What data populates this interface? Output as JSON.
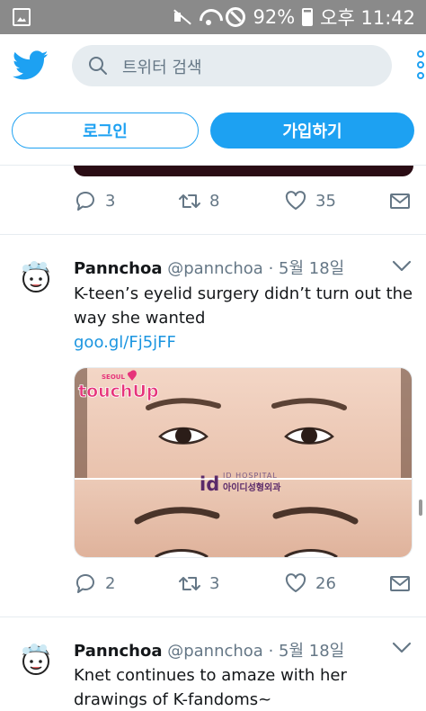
{
  "status_bar": {
    "battery": "92%",
    "time": "오후 11:42"
  },
  "header": {
    "search_placeholder": "트위터 검색"
  },
  "auth": {
    "login_label": "로그인",
    "signup_label": "가입하기"
  },
  "prev_tweet_actions": {
    "replies": "3",
    "retweets": "8",
    "likes": "35"
  },
  "tweets": [
    {
      "name": "Pannchoa",
      "handle": "@pannchoa",
      "dot": "·",
      "date": "5월 18일",
      "text_line1": "K-teen’s eyelid surgery didn’t turn out the",
      "text_line2": "way she wanted",
      "link": "goo.gl/Fj5jFF",
      "media": {
        "logo_word": "touchUp",
        "logo_small": "SEOUL",
        "hospital_en": "ID HOSPITAL",
        "hospital_ko": "아이디성형외과",
        "hospital_mark": "id"
      },
      "replies": "2",
      "retweets": "3",
      "likes": "26"
    },
    {
      "name": "Pannchoa",
      "handle": "@pannchoa",
      "dot": "·",
      "date": "5월 18일",
      "text_line1": "Knet continues to amaze with her",
      "text_line2": "drawings of K-fandoms~"
    }
  ],
  "colors": {
    "twitter_blue": "#1da1f2",
    "link_blue": "#1b95e0",
    "gray_text": "#657786",
    "status_bar": "#8a8a8a"
  }
}
